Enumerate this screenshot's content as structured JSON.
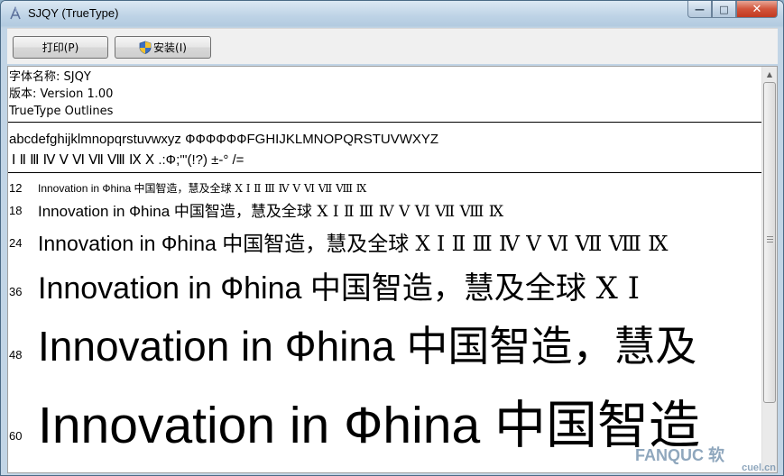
{
  "window": {
    "title": "SJQY (TrueType)",
    "min_glyph": "—",
    "max_glyph": "□",
    "close_glyph": "✕"
  },
  "toolbar": {
    "print_label": "打印(P)",
    "install_label": "安装(I)"
  },
  "info": {
    "font_name": "字体名称: SJQY",
    "version": "版本: Version 1.00",
    "outline": "TrueType Outlines"
  },
  "charset": {
    "line1": "abcdefghijklmnopqrstuvwxyz ФФФФФФFGHIJKLMNOPQRSTUVWXYZ",
    "line2": "Ⅰ Ⅱ Ⅲ Ⅳ Ⅴ Ⅵ Ⅶ Ⅷ Ⅸ Ⅹ .:Ф;'\"(!?) ±-°  /="
  },
  "samples": [
    {
      "size": "12",
      "latin": "Innovation in Фhina ",
      "cjk": "中国智造，慧及全球 Ⅹ Ⅰ Ⅱ Ⅲ Ⅳ Ⅴ Ⅵ Ⅶ Ⅷ Ⅸ"
    },
    {
      "size": "18",
      "latin": "Innovation in Фhina ",
      "cjk": "中国智造，慧及全球 Ⅹ Ⅰ Ⅱ Ⅲ Ⅳ Ⅴ Ⅵ Ⅶ Ⅷ Ⅸ"
    },
    {
      "size": "24",
      "latin": "Innovation in Фhina ",
      "cjk": "中国智造，慧及全球 Ⅹ Ⅰ Ⅱ Ⅲ Ⅳ Ⅴ Ⅵ Ⅶ Ⅷ Ⅸ"
    },
    {
      "size": "36",
      "latin": "Innovation in Фhina ",
      "cjk": "中国智造，慧及全球 Ⅹ Ⅰ"
    },
    {
      "size": "48",
      "latin": "Innovation in Фhina ",
      "cjk": "中国智造，慧及"
    },
    {
      "size": "60",
      "latin": "Innovation in Фhina ",
      "cjk": "中国智造"
    }
  ],
  "watermark": {
    "main": "FANQUC 软",
    "sub": "cuel.cn"
  },
  "colors": {
    "title_bar": "#bed3e6",
    "close_button": "#d2543b",
    "content_bg": "#ffffff"
  }
}
